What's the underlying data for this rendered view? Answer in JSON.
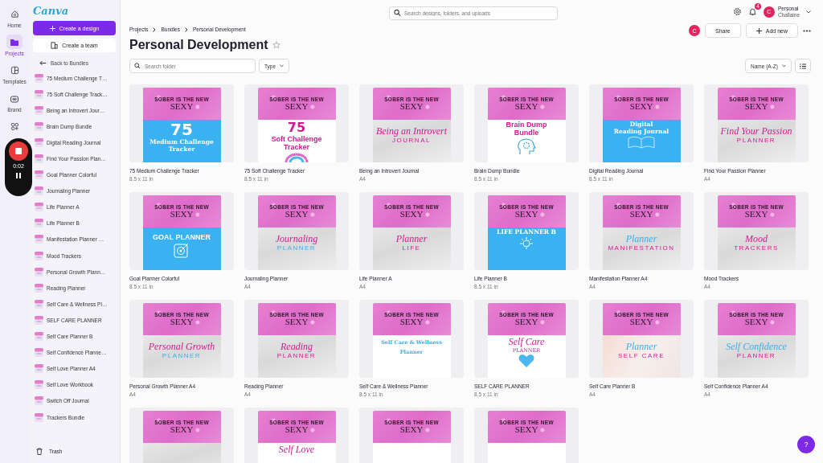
{
  "rail": [
    {
      "label": "Home",
      "selected": false
    },
    {
      "label": "Projects",
      "selected": true
    },
    {
      "label": "Templates",
      "selected": false
    },
    {
      "label": "Brand",
      "selected": false
    },
    {
      "selected": false
    }
  ],
  "recorder": {
    "time": "0:02"
  },
  "sidebar": {
    "logo": "Canva",
    "create_design": "Create a design",
    "create_team": "Create a team",
    "back": "Back to Bundles",
    "items": [
      "75 Medium Challenge T…",
      "75 Soft Challenge Track…",
      "Being an Introvert Jour…",
      "Brain Dump Bundle",
      "Digital Reading Journal",
      "Find Your Passion Plan…",
      "Goal Planner Colorful",
      "Journaling Planner",
      "Life Planner A",
      "Life Planner B",
      "Manifestation Planner …",
      "Mood Trackers",
      "Personal Growth Plann…",
      "Reading Planner",
      "Self Care & Wellness Pl…",
      "SELF CARE PLANNER",
      "Self Care Planner B",
      "Self Confidence Planne…",
      "Self Love Planner A4",
      "Self Love Workbook",
      "Switch Off Journal",
      "Trackers Bundle"
    ],
    "trash": "Trash"
  },
  "topbar": {
    "search_placeholder": "Search designs, folders, and uploads",
    "notifications": "4",
    "account": "Personal",
    "user": "Challaine",
    "avatar": "C"
  },
  "breadcrumb": [
    "Projects",
    "Bundles",
    "Personal Development"
  ],
  "title": "Personal Development",
  "actions": {
    "avatar": "C",
    "share": "Share",
    "add_new": "Add new"
  },
  "toolbar": {
    "search_placeholder": "Search folder",
    "type": "Type",
    "sort": "Name (A-Z)"
  },
  "designs": [
    {
      "name": "75 Medium Challenge Tracker",
      "size": "8.5 x 11 in",
      "kind": "blue",
      "tagline": "SOBER IS THE NEW",
      "heading": "SEXY",
      "lines": [
        {
          "text": "75",
          "kind": "number-white"
        },
        {
          "text": "Medium Challenge",
          "kind": "serif-white"
        },
        {
          "text": "Tracker",
          "kind": "serif-white"
        }
      ]
    },
    {
      "name": "75 Soft Challenge Tracker",
      "size": "8.5 x 11 in",
      "kind": "white",
      "tagline": "SOBER IS THE NEW",
      "heading": "SEXY",
      "lines": [
        {
          "text": "75",
          "kind": "number-pink"
        },
        {
          "text": "Soft Challenge",
          "kind": "bold-pink"
        },
        {
          "text": "Tracker",
          "kind": "bold-pink"
        }
      ]
    },
    {
      "name": "Being an Introvert Journal",
      "size": "A4",
      "kind": "gray",
      "tagline": "SOBER IS THE NEW",
      "heading": "SEXY",
      "lines": [
        {
          "text": "Being an Introvert",
          "kind": "script-pink"
        },
        {
          "text": "JOURNAL",
          "kind": "caps-pink"
        }
      ]
    },
    {
      "name": "Brain Dump Bundle",
      "size": "8.5 x 11 in",
      "kind": "white",
      "tagline": "SOBER IS THE NEW",
      "heading": "SEXY",
      "lines": [
        {
          "text": "Brain Dump",
          "kind": "bold-pink"
        },
        {
          "text": "Bundle",
          "kind": "bold-pink"
        }
      ]
    },
    {
      "name": "Digital Reading Journal",
      "size": "8.5 x 11 in",
      "kind": "blue",
      "tagline": "SOBER IS THE NEW",
      "heading": "SEXY",
      "lines": [
        {
          "text": "Digital",
          "kind": "serif-white"
        },
        {
          "text": "Reading Journal",
          "kind": "serif-white"
        }
      ]
    },
    {
      "name": "Find Your Passion Planner",
      "size": "A4",
      "kind": "gray",
      "tagline": "SOBER IS THE NEW",
      "heading": "SEXY",
      "lines": [
        {
          "text": "Find Your Passion",
          "kind": "script-pink"
        },
        {
          "text": "PLANNER",
          "kind": "caps-pink"
        }
      ]
    },
    {
      "name": "Goal Planner Colorful",
      "size": "8.5 x 11 in",
      "kind": "blue",
      "tagline": "SOBER IS THE NEW",
      "heading": "SEXY",
      "lines": [
        {
          "text": "GOAL PLANNER",
          "kind": "bold-white"
        }
      ]
    },
    {
      "name": "Journaling Planner",
      "size": "A4",
      "kind": "gray",
      "tagline": "SOBER IS THE NEW",
      "heading": "SEXY",
      "lines": [
        {
          "text": "Journaling",
          "kind": "script-pink"
        },
        {
          "text": "PLANNER",
          "kind": "caps-blue"
        }
      ]
    },
    {
      "name": "Life Planner A",
      "size": "A4",
      "kind": "gray",
      "tagline": "SOBER IS THE NEW",
      "heading": "SEXY",
      "lines": [
        {
          "text": "Planner",
          "kind": "script-pink"
        },
        {
          "text": "LIFE",
          "kind": "caps-pink"
        }
      ]
    },
    {
      "name": "Life Planner B",
      "size": "8.5 x 11 in",
      "kind": "blue",
      "tagline": "SOBER IS THE NEW",
      "heading": "SEXY",
      "lines": [
        {
          "text": "LIFE PLANNER B",
          "kind": "serif-white"
        }
      ]
    },
    {
      "name": "Manifestation Planner A4",
      "size": "A4",
      "kind": "gray",
      "tagline": "SOBER IS THE NEW",
      "heading": "SEXY",
      "lines": [
        {
          "text": "Planner",
          "kind": "script-blue"
        },
        {
          "text": "MANIFESTATION",
          "kind": "caps-pink"
        }
      ]
    },
    {
      "name": "Mood Trackers",
      "size": "A4",
      "kind": "gray",
      "tagline": "SOBER IS THE NEW",
      "heading": "SEXY",
      "lines": [
        {
          "text": "Mood",
          "kind": "script-pink"
        },
        {
          "text": "TRACKERS",
          "kind": "caps-pink"
        }
      ]
    },
    {
      "name": "Personal Growth Planner A4",
      "size": "A4",
      "kind": "gray",
      "tagline": "SOBER IS THE NEW",
      "heading": "SEXY",
      "lines": [
        {
          "text": "Personal Growth",
          "kind": "script-pink"
        },
        {
          "text": "PLANNER",
          "kind": "caps-blue"
        }
      ]
    },
    {
      "name": "Reading Planner",
      "size": "A4",
      "kind": "gray",
      "tagline": "SOBER IS THE NEW",
      "heading": "SEXY",
      "lines": [
        {
          "text": "Reading",
          "kind": "script-pink"
        },
        {
          "text": "PLANNER",
          "kind": "caps-pink"
        }
      ]
    },
    {
      "name": "Self Care & Wellness Planner",
      "size": "8.5 x 11 in",
      "kind": "white",
      "tagline": "SOBER IS THE NEW",
      "heading": "SEXY",
      "lines": [
        {
          "text": "Self Care & Wellness",
          "kind": "serif-blue"
        },
        {
          "text": "Planner",
          "kind": "serif-blue"
        }
      ]
    },
    {
      "name": "SELF CARE PLANNER",
      "size": "8.5 x 11 in",
      "kind": "white",
      "tagline": "SOBER IS THE NEW",
      "heading": "SEXY",
      "lines": [
        {
          "text": "Self Care",
          "kind": "script-pink"
        },
        {
          "text": "PLANNER",
          "kind": "serif-pink"
        }
      ]
    },
    {
      "name": "Self Care Planner B",
      "size": "A4",
      "kind": "peach",
      "tagline": "SOBER IS THE NEW",
      "heading": "SEXY",
      "lines": [
        {
          "text": "Planner",
          "kind": "script-blue"
        },
        {
          "text": "SELF CARE",
          "kind": "caps-pink"
        }
      ]
    },
    {
      "name": "Self Confidence Planner A4",
      "size": "A4",
      "kind": "gray",
      "tagline": "SOBER IS THE NEW",
      "heading": "SEXY",
      "lines": [
        {
          "text": "Self Confidence",
          "kind": "script-blue"
        },
        {
          "text": "PLANNER",
          "kind": "caps-pink"
        }
      ]
    },
    {
      "kind": "gray",
      "tagline": "SOBER IS THE NEW",
      "heading": "SEXY"
    },
    {
      "kind": "white",
      "tagline": "SOBER IS THE NEW",
      "heading": "SEXY",
      "lines": [
        {
          "text": "Self Love",
          "kind": "script-pink"
        }
      ]
    },
    {
      "kind": "white",
      "tagline": "SOBER IS THE NEW",
      "heading": "SEXY"
    },
    {
      "kind": "white",
      "tagline": "SOBER IS THE NEW",
      "heading": "SEXY"
    }
  ],
  "help": "?"
}
